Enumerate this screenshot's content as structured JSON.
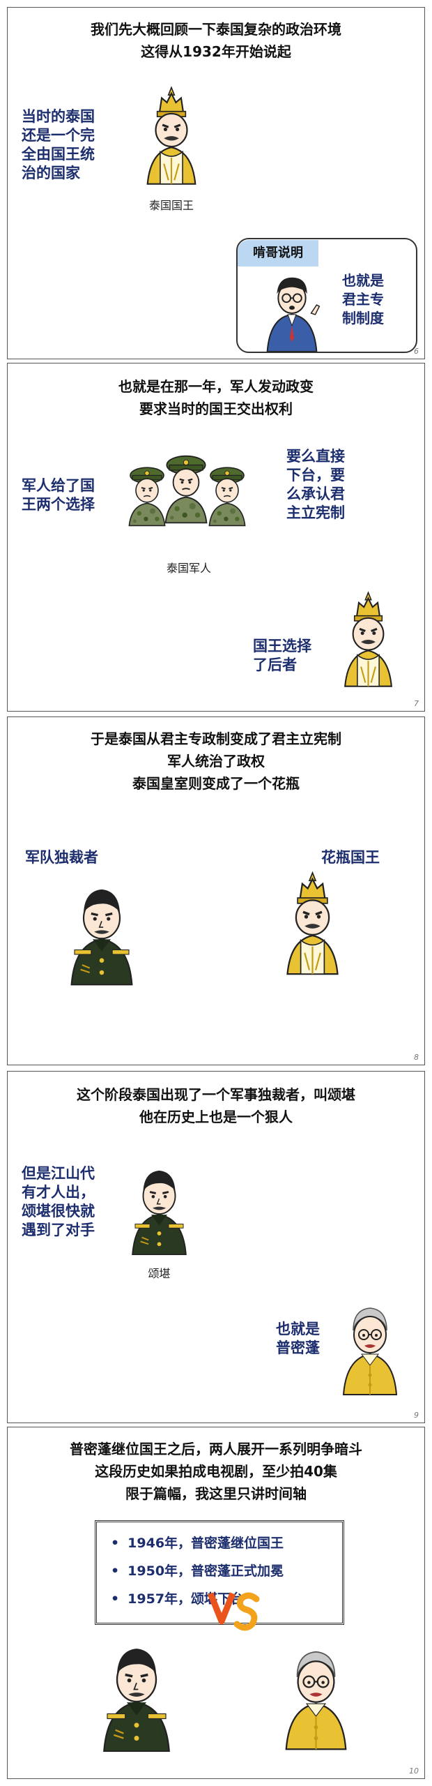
{
  "panels": [
    {
      "title_lines": [
        "我们先大概回顾一下泰国复杂的政治环境",
        "这得从1932年开始说起"
      ],
      "left_text": [
        "当时的泰国",
        "还是一个完",
        "全由国王统",
        "治的国家"
      ],
      "caption": "泰国国王",
      "explain_tag": "啃哥说明",
      "explain_text": [
        "也就是",
        "君主专",
        "制制度"
      ],
      "page_number": "6"
    },
    {
      "title_lines": [
        "也就是在那一年，军人发动政变",
        "要求当时的国王交出权利"
      ],
      "left_text": [
        "军人给了国",
        "王两个选择"
      ],
      "right_text": [
        "要么直接",
        "下台，要",
        "么承认君",
        "主立宪制"
      ],
      "caption": "泰国军人",
      "bottom_text": [
        "国王选择",
        "了后者"
      ],
      "page_number": "7"
    },
    {
      "title_lines": [
        "于是泰国从君主专政制变成了君主立宪制",
        "军人统治了政权",
        "泰国皇室则变成了一个花瓶"
      ],
      "left_label": "军队独裁者",
      "right_label": "花瓶国王",
      "page_number": "8"
    },
    {
      "title_lines": [
        "这个阶段泰国出现了一个军事独裁者，叫颂堪",
        "他在历史上也是一个狠人"
      ],
      "left_text": [
        "但是江山代",
        "有才人出，",
        "颂堪很快就",
        "遇到了对手"
      ],
      "caption": "颂堪",
      "right_text": [
        "也就是",
        "普密蓬"
      ],
      "page_number": "9"
    },
    {
      "title_lines": [
        "普密蓬继位国王之后，两人展开一系列明争暗斗",
        "这段历史如果拍成电视剧，至少拍40集",
        "限于篇幅，我这里只讲时间轴"
      ],
      "timeline": [
        "1946年，普密蓬继位国王",
        "1950年，普密蓬正式加冕",
        "1957年，颂堪下台"
      ],
      "page_number": "10"
    }
  ],
  "colors": {
    "text_blue": "#1d2e6e",
    "gold": "#e8c233",
    "army_green": "#4e6a2c",
    "uniform_dark": "#2a3a22",
    "tag_blue": "#bcd7f2"
  },
  "icons": [
    "crown-icon",
    "pointing-hand-icon",
    "vs-icon",
    "bullet-icon"
  ]
}
